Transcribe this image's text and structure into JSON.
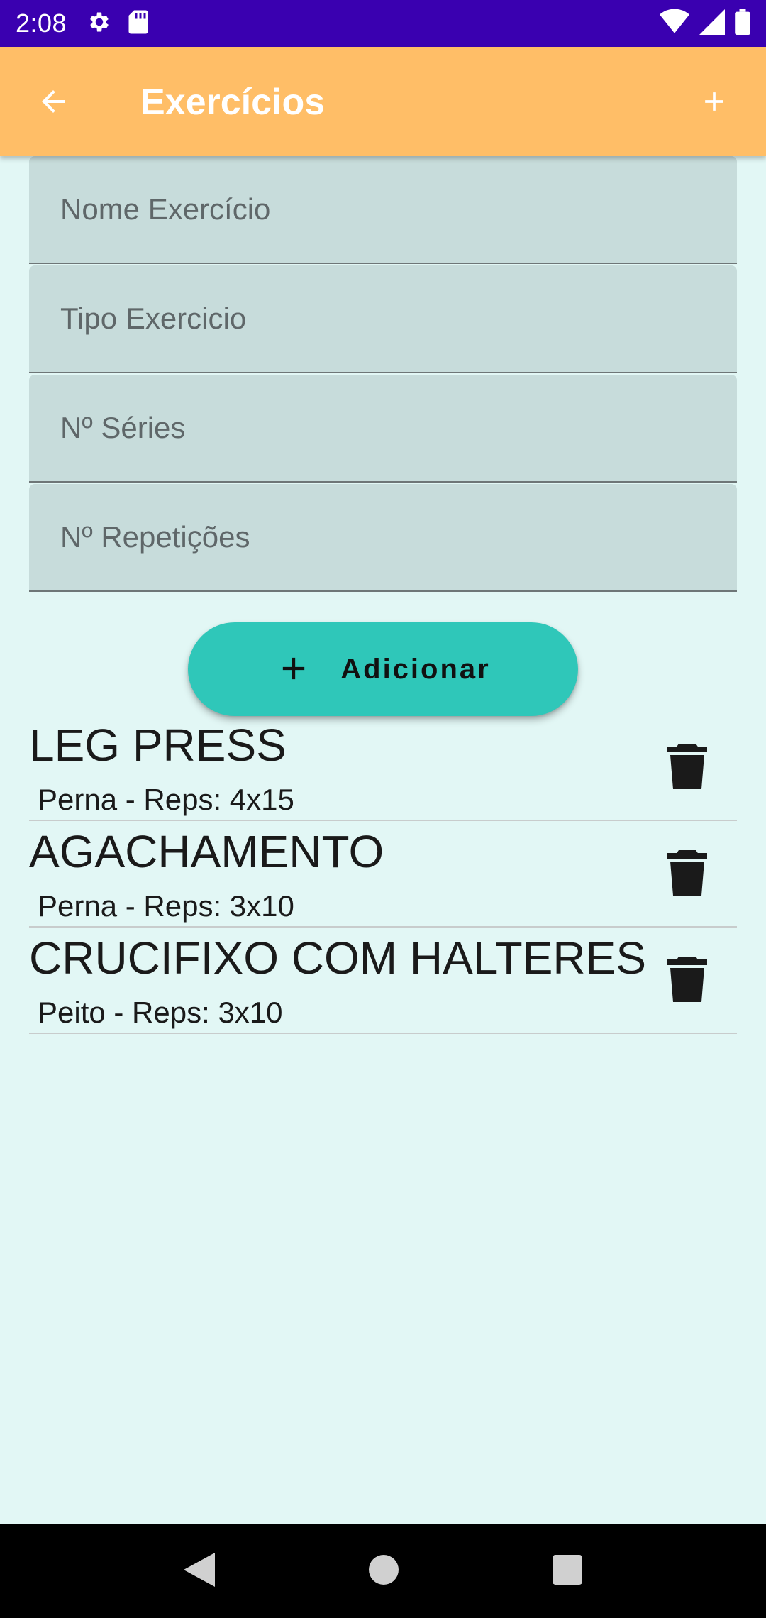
{
  "status_bar": {
    "time": "2:08",
    "icons": [
      "gear-icon",
      "sd-card-icon",
      "wifi-icon",
      "signal-icon",
      "battery-icon"
    ]
  },
  "app_bar": {
    "title": "Exercícios",
    "back_icon": "arrow-back-icon",
    "add_icon": "plus-icon",
    "background": "#ffbe67"
  },
  "form": {
    "fields": [
      {
        "placeholder": "Nome Exercício",
        "value": ""
      },
      {
        "placeholder": "Tipo Exercicio",
        "value": ""
      },
      {
        "placeholder": "Nº Séries",
        "value": ""
      },
      {
        "placeholder": "Nº Repetições",
        "value": ""
      }
    ],
    "add_button_label": "Adicionar",
    "add_button_color": "#2fc7b9"
  },
  "exercises": [
    {
      "name": "LEG PRESS",
      "detail": "Perna - Reps: 4x15"
    },
    {
      "name": "AGACHAMENTO",
      "detail": "Perna - Reps: 3x10"
    },
    {
      "name": "CRUCIFIXO COM HALTERES",
      "detail": "Peito - Reps: 3x10"
    }
  ],
  "nav_bar": {
    "buttons": [
      "back-triangle-icon",
      "home-circle-icon",
      "recents-square-icon"
    ]
  }
}
